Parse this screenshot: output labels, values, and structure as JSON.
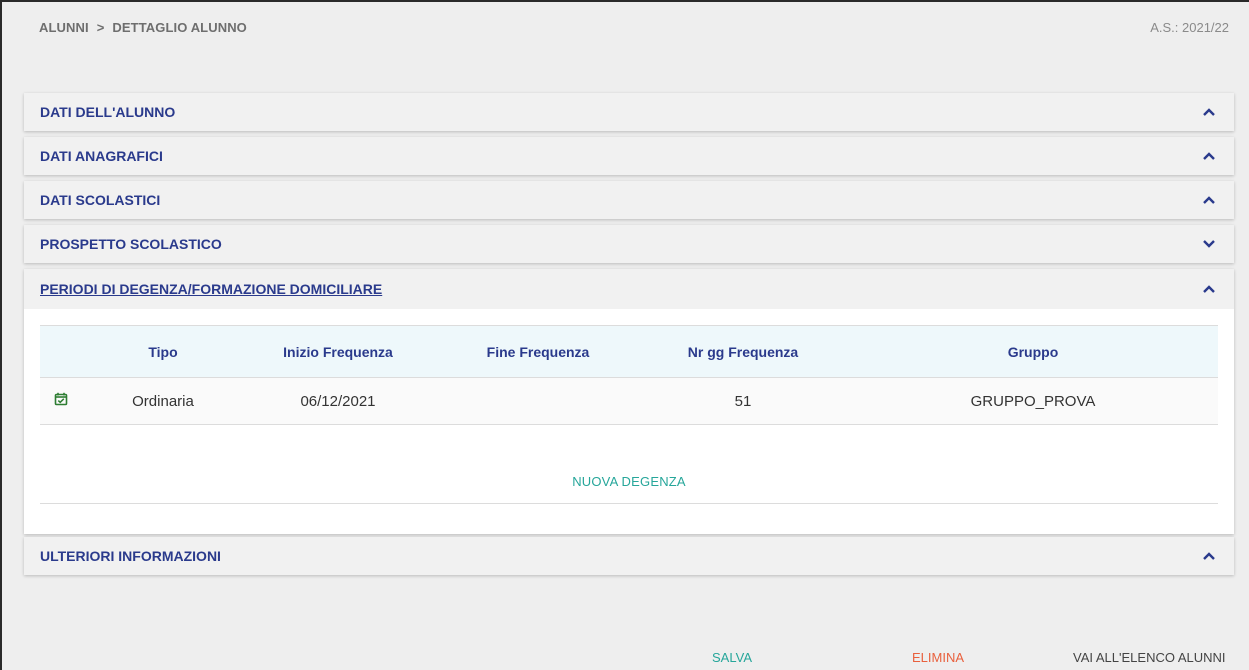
{
  "breadcrumb": {
    "parent": "ALUNNI",
    "separator": ">",
    "current": "DETTAGLIO ALUNNO"
  },
  "school_year": "A.S.: 2021/22",
  "sections": {
    "dati_alunno": {
      "title": "DATI DELL'ALUNNO",
      "chevron": "chevron-up-icon"
    },
    "dati_anagrafici": {
      "title": "DATI ANAGRAFICI",
      "chevron": "chevron-up-icon"
    },
    "dati_scolastici": {
      "title": "DATI SCOLASTICI",
      "chevron": "chevron-up-icon"
    },
    "prospetto_scolastico": {
      "title": "PROSPETTO SCOLASTICO",
      "chevron": "chevron-down-icon"
    },
    "periodi_degenza": {
      "title": "PERIODI DI DEGENZA/FORMAZIONE DOMICILIARE",
      "chevron": "chevron-up-icon"
    },
    "ulteriori_info": {
      "title": "ULTERIORI INFORMAZIONI",
      "chevron": "chevron-up-icon"
    }
  },
  "degenza_table": {
    "headers": [
      "Tipo",
      "Inizio Frequenza",
      "Fine Frequenza",
      "Nr gg Frequenza",
      "Gruppo"
    ],
    "rows": [
      {
        "icon": "calendar-check-icon",
        "tipo": "Ordinaria",
        "inizio": "06/12/2021",
        "fine": "",
        "nr_gg": "51",
        "gruppo": "GRUPPO_PROVA"
      }
    ]
  },
  "new_degenza_label": "NUOVA DEGENZA",
  "footer": {
    "save": "SALVA",
    "delete": "ELIMINA",
    "list": "VAI ALL'ELENCO ALUNNI"
  },
  "colors": {
    "title_blue": "#2a3a8c",
    "accent_teal": "#26a69a",
    "danger_orange": "#e9603d",
    "icon_green": "#2e7d32"
  }
}
